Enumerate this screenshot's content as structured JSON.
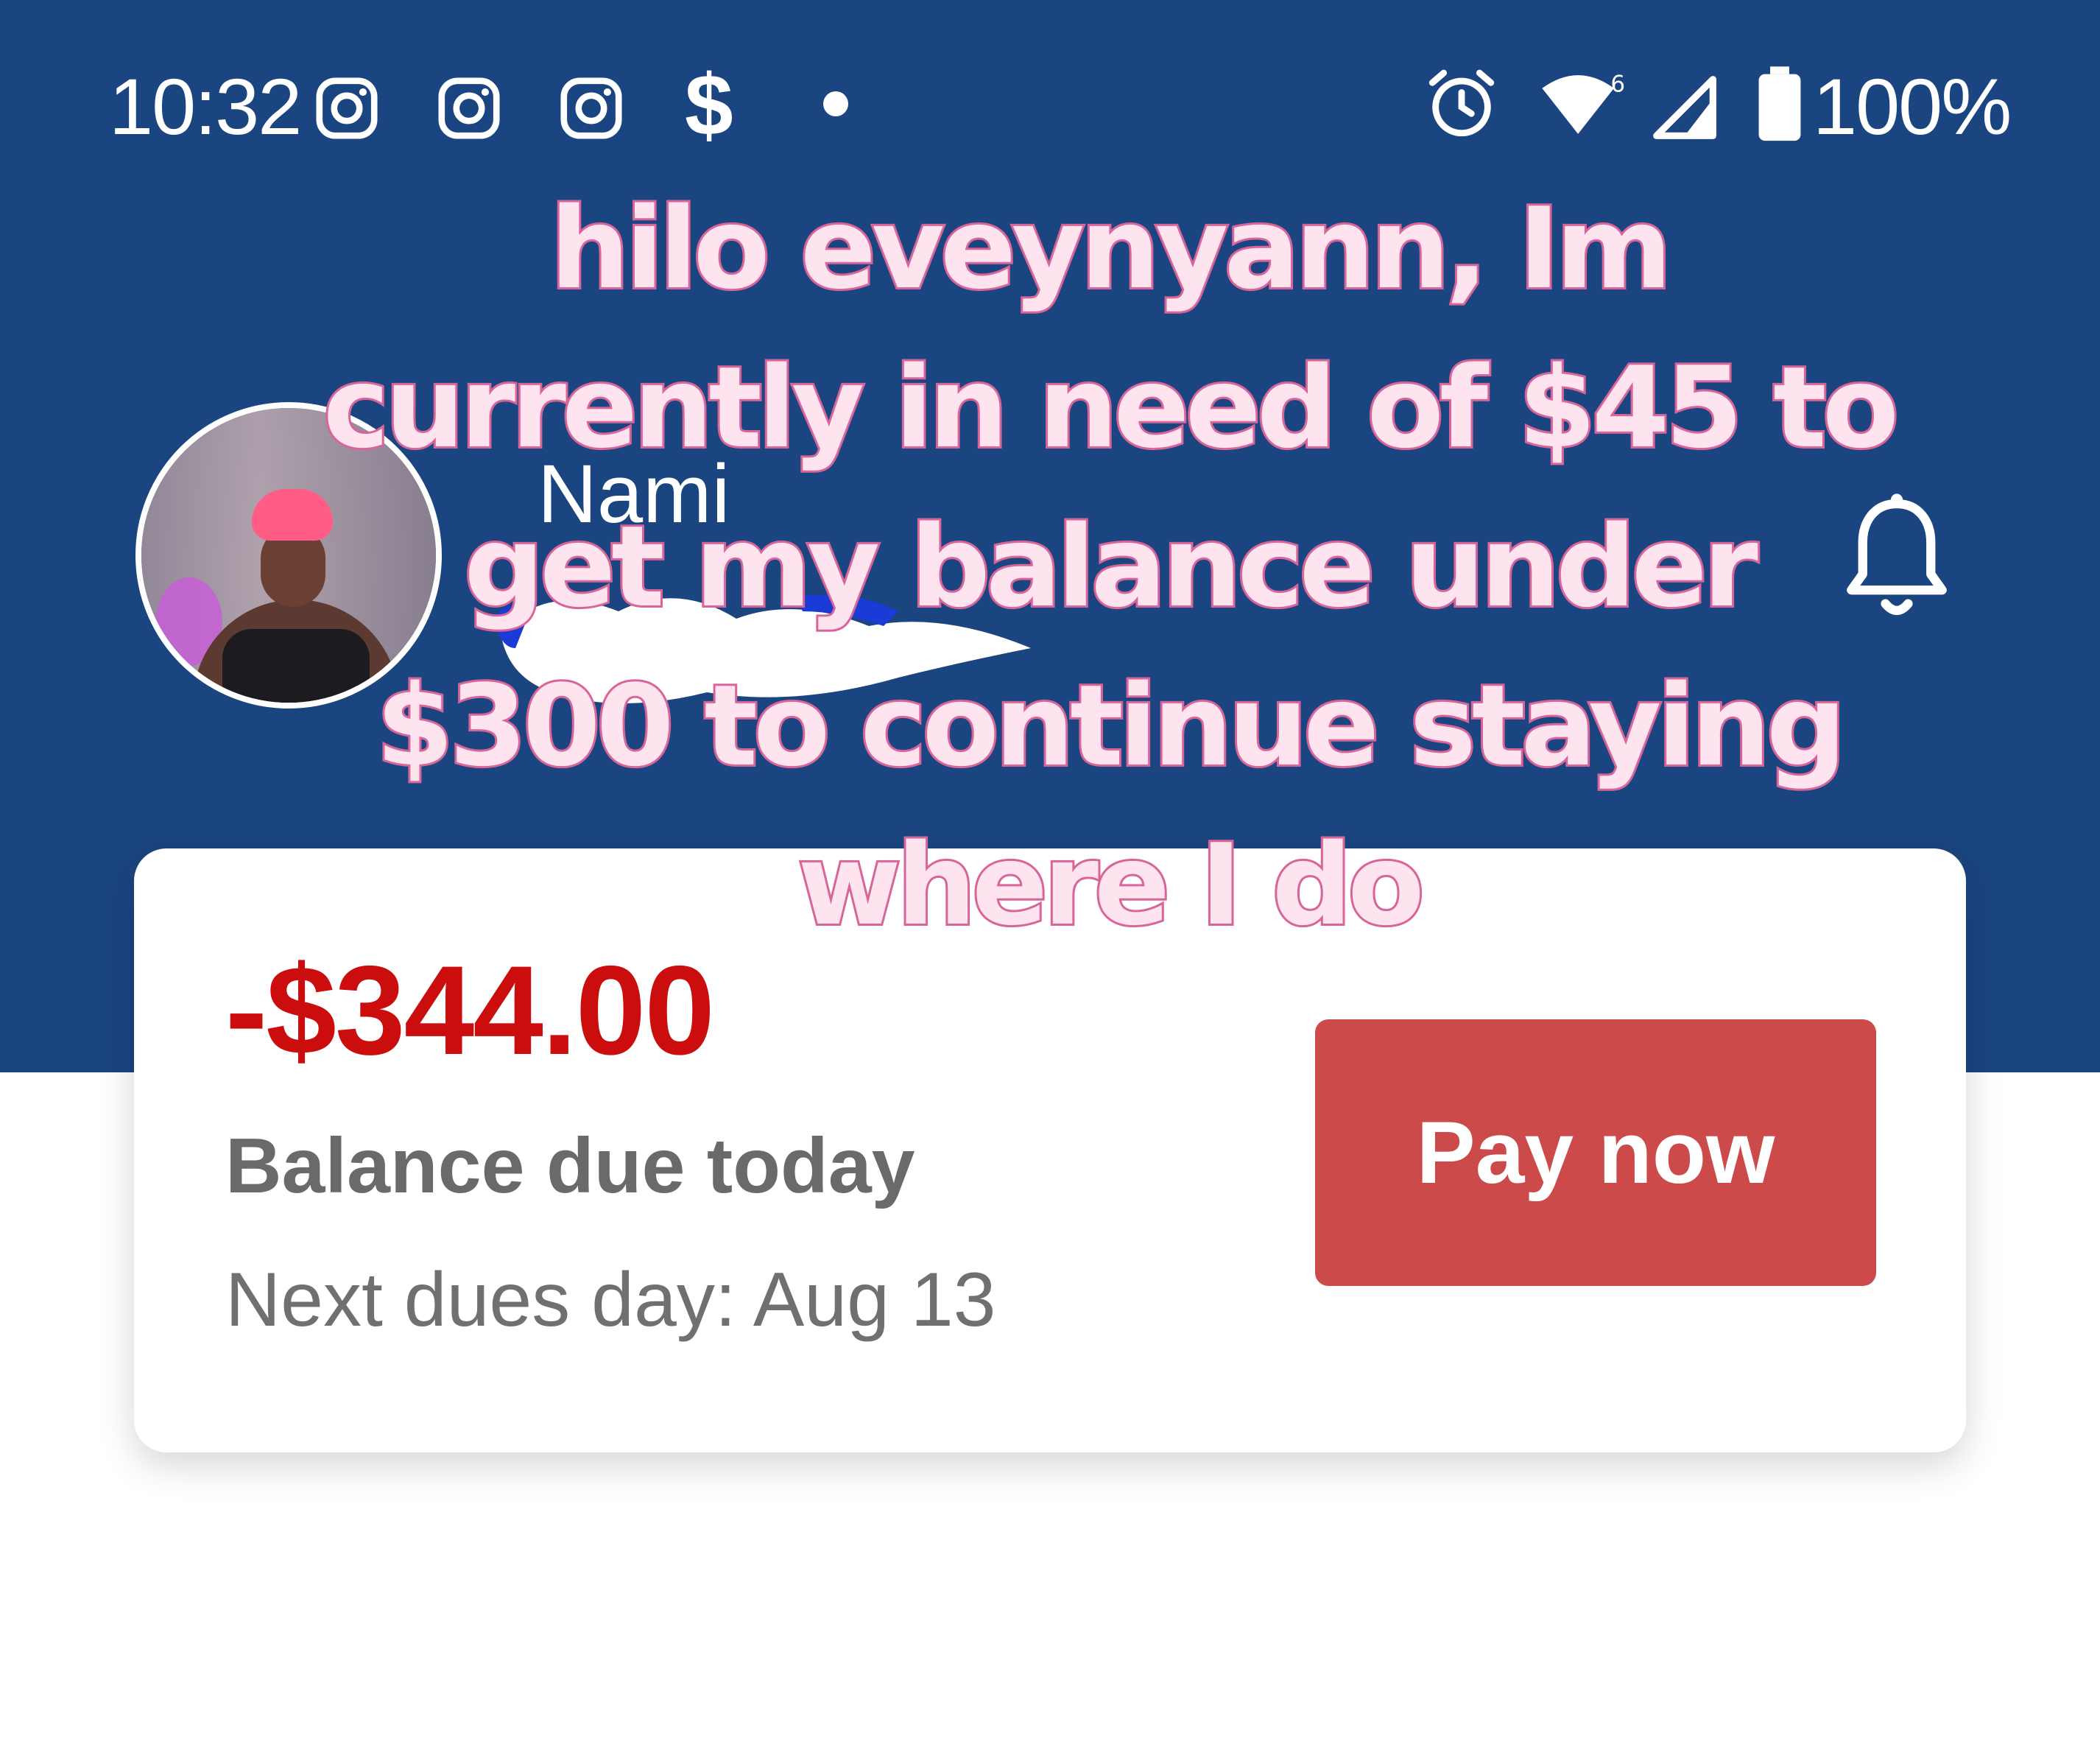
{
  "status_bar": {
    "time": "10:32",
    "notification_icons": [
      "instagram-icon",
      "instagram-icon",
      "instagram-icon",
      "dollar-sign-icon",
      "dot-icon"
    ],
    "dollar_glyph": "$",
    "system_icons": [
      "alarm-icon",
      "wifi-icon",
      "cell-signal-icon",
      "battery-icon"
    ],
    "battery_percent": "100%"
  },
  "header": {
    "user_name": "Nami",
    "notification_icon": "bell-icon",
    "background_color": "#1b4580"
  },
  "overlay_caption": {
    "lines": [
      "hilo eveynyann, Im",
      "currently in need of $45 to",
      "get my balance under",
      "$300 to continue staying",
      "where I do"
    ],
    "fill_color": "#fde4ee",
    "outline_color": "#d9659a"
  },
  "balance_card": {
    "amount": "-$344.00",
    "amount_color": "#cc0d0d",
    "label": "Balance due today",
    "next_dues": "Next dues day: Aug 13",
    "pay_button_label": "Pay now",
    "pay_button_color": "#cd4a4b"
  }
}
